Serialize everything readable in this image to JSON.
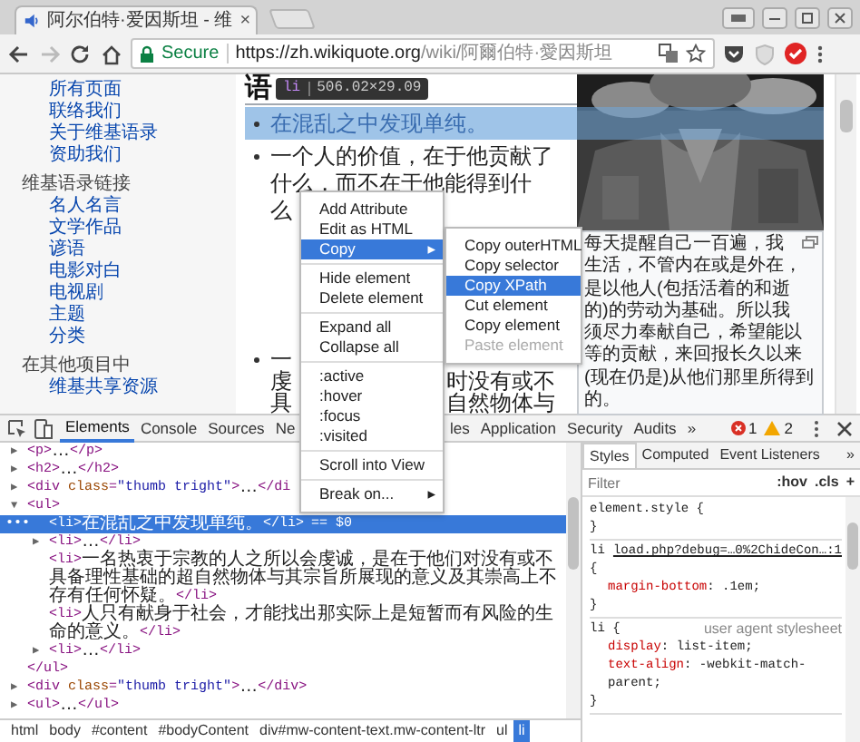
{
  "browser": {
    "tab": {
      "title": "阿尔伯特·爱因斯坦 - 维",
      "close": "×"
    },
    "omnibox": {
      "security": "Secure",
      "url_host": "https://zh.wikiquote.org",
      "url_path": "/wiki/阿爾伯特·愛因斯坦"
    }
  },
  "sidebar": {
    "groups": [
      {
        "links": [
          "所有页面",
          "联络我们",
          "关于维基语录",
          "资助我们"
        ]
      },
      {
        "heading": "维基语录链接",
        "links": [
          "名人名言",
          "文学作品",
          "谚语",
          "电影对白",
          "电视剧",
          "主题",
          "分类"
        ]
      },
      {
        "heading": "在其他项目中",
        "links": [
          "维基共享资源"
        ]
      }
    ]
  },
  "article": {
    "heading": "语",
    "inspect_tooltip": {
      "tag": "li",
      "size": "506.02×29.09"
    },
    "list": [
      {
        "highlighted": true,
        "lines": [
          [
            "在混乱之中发现单纯。"
          ]
        ]
      },
      {
        "highlighted": false,
        "lines": [
          [
            "一个人的价值，在于他贡献了"
          ],
          [
            "什么，而不在于他能得到什"
          ],
          [
            "么"
          ]
        ]
      },
      {
        "highlighted": false,
        "lines": [
          [
            "一"
          ],
          [
            "虔",
            "时没有或不"
          ],
          [
            "具",
            "自然物体与"
          ]
        ]
      }
    ],
    "caption": {
      "lines": [
        "每天提醒自己一百遍，我",
        "生活，不管内在或是外在，",
        "是以他人(包括活着的和逝",
        "的)的劳动为基础。所以我",
        "须尽力奉献自己，希望能以",
        "等的贡献，来回报长久以来",
        "(现在仍是)从他们那里所得到",
        "的。"
      ]
    }
  },
  "context_menu": {
    "items": [
      {
        "kind": "item",
        "label": "Add Attribute",
        "selected": false
      },
      {
        "kind": "item",
        "label": "Edit as HTML",
        "selected": false
      },
      {
        "kind": "item",
        "label": "Copy",
        "arrow": "▸",
        "selected": true
      },
      {
        "kind": "separator"
      },
      {
        "kind": "item",
        "label": "Hide element",
        "selected": false
      },
      {
        "kind": "item",
        "label": "Delete element",
        "selected": false
      },
      {
        "kind": "separator"
      },
      {
        "kind": "item",
        "label": "Expand all",
        "selected": false
      },
      {
        "kind": "item",
        "label": "Collapse all",
        "selected": false
      },
      {
        "kind": "separator"
      },
      {
        "kind": "item",
        "label": ":active",
        "selected": false
      },
      {
        "kind": "item",
        "label": ":hover",
        "selected": false
      },
      {
        "kind": "item",
        "label": ":focus",
        "selected": false
      },
      {
        "kind": "item",
        "label": ":visited",
        "selected": false
      },
      {
        "kind": "separator"
      },
      {
        "kind": "item",
        "label": "Scroll into View",
        "selected": false
      },
      {
        "kind": "separator"
      },
      {
        "kind": "item",
        "label": "Break on...",
        "arrow": "▸",
        "selected": false
      }
    ],
    "submenu": {
      "items": [
        {
          "label": "Copy outerHTML",
          "selected": false,
          "disabled": false
        },
        {
          "label": "Copy selector",
          "selected": false,
          "disabled": false
        },
        {
          "label": "Copy XPath",
          "selected": true,
          "disabled": false
        },
        {
          "label": "Cut element",
          "selected": false,
          "disabled": false
        },
        {
          "label": "Copy element",
          "selected": false,
          "disabled": false
        },
        {
          "label": "Paste element",
          "selected": false,
          "disabled": true
        }
      ]
    }
  },
  "devtools": {
    "tab_groups": [
      [
        {
          "label": "Elements",
          "selected": true
        },
        {
          "label": "Console",
          "selected": false
        },
        {
          "label": "Sources",
          "selected": false
        },
        {
          "label": "Ne",
          "selected": false
        }
      ],
      [
        {
          "label": "les",
          "selected": false
        },
        {
          "label": "Application",
          "selected": false
        },
        {
          "label": "Security",
          "selected": false
        },
        {
          "label": "Audits",
          "selected": false
        }
      ]
    ],
    "more_tabs": "»",
    "error_count": "1",
    "warning_count": "2"
  },
  "elements_tree": {
    "nodes": [
      {
        "toggle": "▶",
        "selected": false,
        "parts": [
          {
            "kind": "tag",
            "text": "<p>"
          },
          {
            "kind": "text",
            "text": "…"
          },
          {
            "kind": "tag",
            "text": "</p>"
          }
        ]
      },
      {
        "toggle": "▶",
        "selected": false,
        "parts": [
          {
            "kind": "tag",
            "text": "<h2>"
          },
          {
            "kind": "text",
            "text": "…"
          },
          {
            "kind": "tag",
            "text": "</h2>"
          }
        ]
      },
      {
        "toggle": "▶",
        "selected": false,
        "parts": [
          {
            "kind": "tag",
            "text": "<div "
          },
          {
            "kind": "attr",
            "text": "class"
          },
          {
            "kind": "tag",
            "text": "="
          },
          {
            "kind": "value",
            "text": "\"thumb tright\""
          },
          {
            "kind": "tag",
            "text": ">"
          },
          {
            "kind": "text",
            "text": "…"
          },
          {
            "kind": "tag",
            "text": "</di"
          }
        ]
      },
      {
        "toggle": "▼",
        "selected": false,
        "parts": [
          {
            "kind": "tag",
            "text": "<ul>"
          }
        ],
        "close_parts": [
          {
            "kind": "tag",
            "text": "</ul>"
          }
        ],
        "children": [
          {
            "selected": true,
            "gutter": "•••",
            "suffix": "== $0",
            "parts": [
              {
                "kind": "tag",
                "text": "<li>"
              },
              {
                "kind": "text",
                "text": "在混乱之中发现单纯。"
              },
              {
                "kind": "tag",
                "text": "</li>"
              }
            ]
          },
          {
            "toggle": "▶",
            "selected": false,
            "parts": [
              {
                "kind": "tag",
                "text": "<li>"
              },
              {
                "kind": "text",
                "text": "…"
              },
              {
                "kind": "tag",
                "text": "</li>"
              }
            ]
          },
          {
            "selected": false,
            "parts": [
              {
                "kind": "tag",
                "text": "<li>"
              },
              {
                "kind": "text",
                "text": "一名热衷于宗教的人之所以会虔诚，是在于他们对没有或不具备理性基础的超自然物体与其宗旨所展现的意义及其崇高上不存有任何怀疑。"
              },
              {
                "kind": "tag",
                "text": "</li>"
              }
            ]
          },
          {
            "selected": false,
            "parts": [
              {
                "kind": "tag",
                "text": "<li>"
              },
              {
                "kind": "text",
                "text": "人只有献身于社会，才能找出那实际上是短暂而有风险的生命的意义。"
              },
              {
                "kind": "tag",
                "text": "</li>"
              }
            ]
          },
          {
            "toggle": "▶",
            "selected": false,
            "parts": [
              {
                "kind": "tag",
                "text": "<li>"
              },
              {
                "kind": "text",
                "text": "…"
              },
              {
                "kind": "tag",
                "text": "</li>"
              }
            ]
          }
        ]
      },
      {
        "toggle": "▶",
        "selected": false,
        "parts": [
          {
            "kind": "tag",
            "text": "<div "
          },
          {
            "kind": "attr",
            "text": "class"
          },
          {
            "kind": "tag",
            "text": "="
          },
          {
            "kind": "value",
            "text": "\"thumb tright\""
          },
          {
            "kind": "tag",
            "text": ">"
          },
          {
            "kind": "text",
            "text": "…"
          },
          {
            "kind": "tag",
            "text": "</div>"
          }
        ]
      },
      {
        "toggle": "▶",
        "selected": false,
        "parts": [
          {
            "kind": "tag",
            "text": "<ul>"
          },
          {
            "kind": "text",
            "text": "…"
          },
          {
            "kind": "tag",
            "text": "</ul>"
          }
        ]
      }
    ]
  },
  "breadcrumbs": [
    {
      "label": "html",
      "selected": false
    },
    {
      "label": "body",
      "selected": false
    },
    {
      "label": "#content",
      "selected": false
    },
    {
      "label": "#bodyContent",
      "selected": false
    },
    {
      "label": "div#mw-content-text.mw-content-ltr",
      "selected": false
    },
    {
      "label": "ul",
      "selected": false
    },
    {
      "label": "li",
      "selected": true
    }
  ],
  "styles": {
    "tabs": [
      {
        "label": "Styles",
        "selected": true
      },
      {
        "label": "Computed",
        "selected": false
      },
      {
        "label": "Event Listeners",
        "selected": false
      }
    ],
    "more_tabs": "»",
    "filter": {
      "placeholder": "Filter"
    },
    "toggles": [
      ":hov",
      ".cls"
    ],
    "add": "+",
    "rules": [
      {
        "selector": "element.style",
        "open": "{",
        "close": "}"
      },
      {
        "selector": "li",
        "source": "load.php?debug=…0%2ChideCon…:1",
        "open": "{",
        "properties": [
          {
            "name": "margin-bottom",
            "colon": ":",
            "value": ".1em;"
          }
        ],
        "close": "}"
      },
      {
        "selector": "li",
        "open": "{",
        "origin": "user agent stylesheet",
        "properties": [
          {
            "name": "display",
            "colon": ":",
            "value": "list-item;"
          },
          {
            "name": "text-align",
            "colon": ":",
            "value": "-webkit-match-parent;"
          }
        ],
        "close": "}"
      }
    ]
  }
}
